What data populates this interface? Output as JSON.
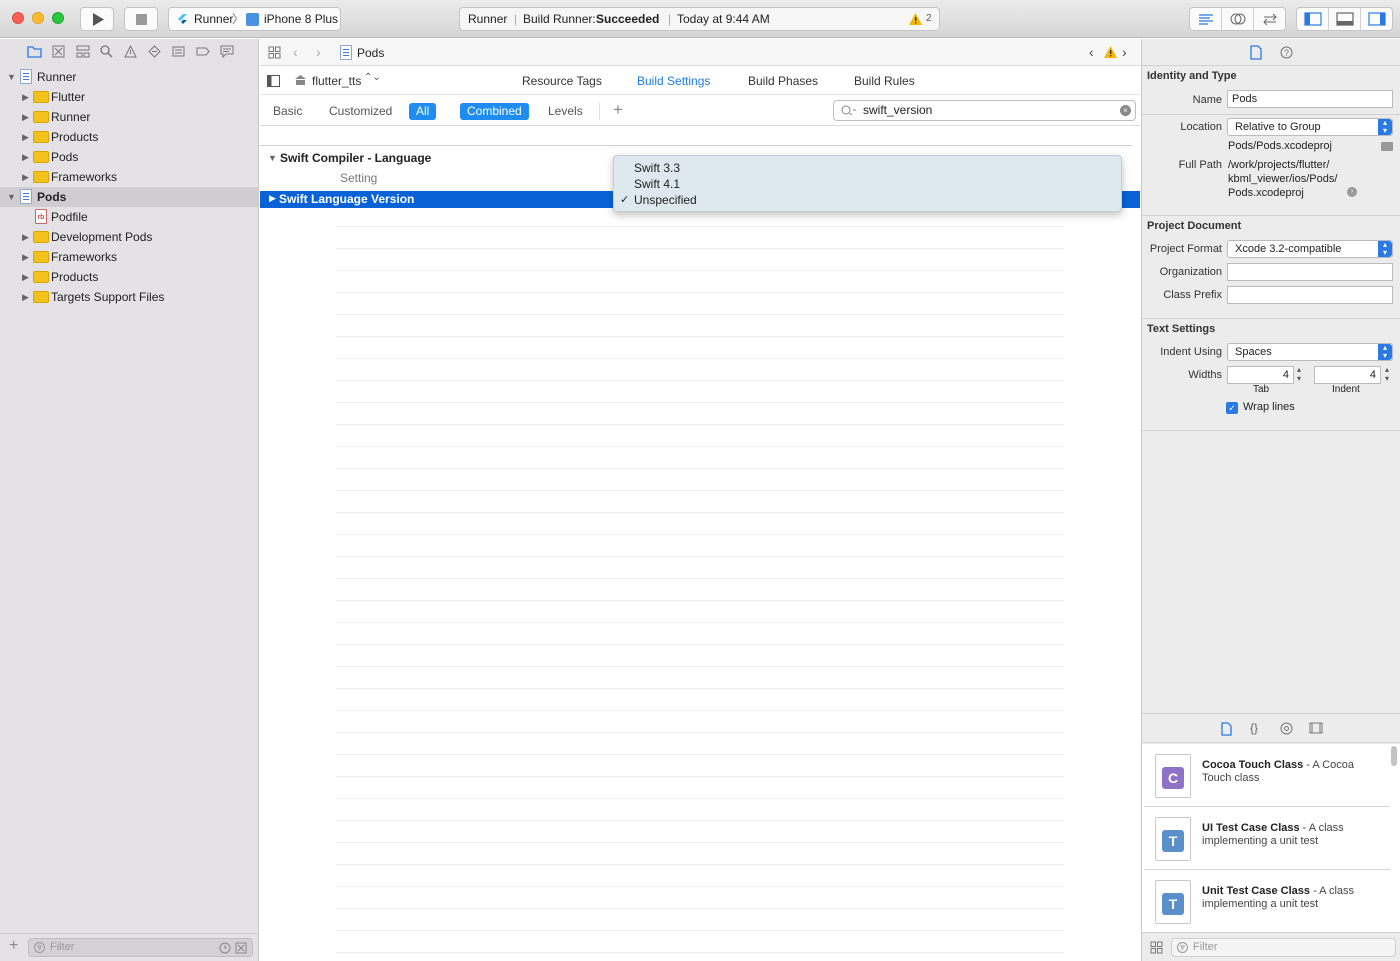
{
  "toolbar": {
    "scheme_target": "Runner",
    "scheme_device": "iPhone 8 Plus",
    "activity_project": "Runner",
    "activity_prefix": "Build Runner: ",
    "activity_status": "Succeeded",
    "activity_time": "Today at 9:44 AM",
    "warning_count": "2"
  },
  "navigator": {
    "items": [
      {
        "label": "Runner",
        "kind": "project"
      },
      {
        "label": "Flutter",
        "kind": "folder"
      },
      {
        "label": "Runner",
        "kind": "folder"
      },
      {
        "label": "Products",
        "kind": "folder"
      },
      {
        "label": "Pods",
        "kind": "folder"
      },
      {
        "label": "Frameworks",
        "kind": "folder"
      },
      {
        "label": "Pods",
        "kind": "project"
      },
      {
        "label": "Podfile",
        "kind": "file"
      },
      {
        "label": "Development Pods",
        "kind": "folder"
      },
      {
        "label": "Frameworks",
        "kind": "folder"
      },
      {
        "label": "Products",
        "kind": "folder"
      },
      {
        "label": "Targets Support Files",
        "kind": "folder"
      }
    ],
    "filter_placeholder": "Filter"
  },
  "editor": {
    "breadcrumb": "Pods",
    "target": "flutter_tts",
    "tabs": [
      "Resource Tags",
      "Build Settings",
      "Build Phases",
      "Build Rules"
    ],
    "filters": {
      "basic": "Basic",
      "customized": "Customized",
      "all": "All",
      "combined": "Combined",
      "levels": "Levels"
    },
    "search_value": "swift_version",
    "section_title": "Swift Compiler - Language",
    "column_setting": "Setting",
    "setting_row": "Swift Language Version",
    "popup_options": [
      "Swift 3.3",
      "Swift 4.1",
      "Unspecified"
    ],
    "popup_checked": "✓"
  },
  "inspector": {
    "identity_header": "Identity and Type",
    "name_label": "Name",
    "name_value": "Pods",
    "location_label": "Location",
    "location_value": "Relative to Group",
    "path_value": "Pods/Pods.xcodeproj",
    "fullpath_label": "Full Path",
    "fullpath_1": "/work/projects/flutter/",
    "fullpath_2": "kbml_viewer/ios/Pods/",
    "fullpath_3": "Pods.xcodeproj",
    "project_doc_header": "Project Document",
    "format_label": "Project Format",
    "format_value": "Xcode 3.2-compatible",
    "org_label": "Organization",
    "prefix_label": "Class Prefix",
    "text_settings_header": "Text Settings",
    "indent_label": "Indent Using",
    "indent_value": "Spaces",
    "widths_label": "Widths",
    "tab_value": "4",
    "indent_width_value": "4",
    "tab_caption": "Tab",
    "indent_caption": "Indent",
    "wrap_label": "Wrap lines"
  },
  "library": {
    "items": [
      {
        "title": "Cocoa Touch Class",
        "desc1": " - A Cocoa",
        "desc2": "Touch class",
        "letter": "C",
        "color": "#8e72c8"
      },
      {
        "title": "UI Test Case Class",
        "desc1": " - A class",
        "desc2": "implementing a unit test",
        "letter": "T",
        "color": "#5b8fc9"
      },
      {
        "title": "Unit Test Case Class",
        "desc1": " - A class",
        "desc2": "implementing a unit test",
        "letter": "T",
        "color": "#5b8fc9"
      }
    ],
    "filter_placeholder": "Filter"
  },
  "colors": {
    "accent": "#1e8cf0",
    "selection": "#0a63d6",
    "warning": "#f5b800"
  }
}
